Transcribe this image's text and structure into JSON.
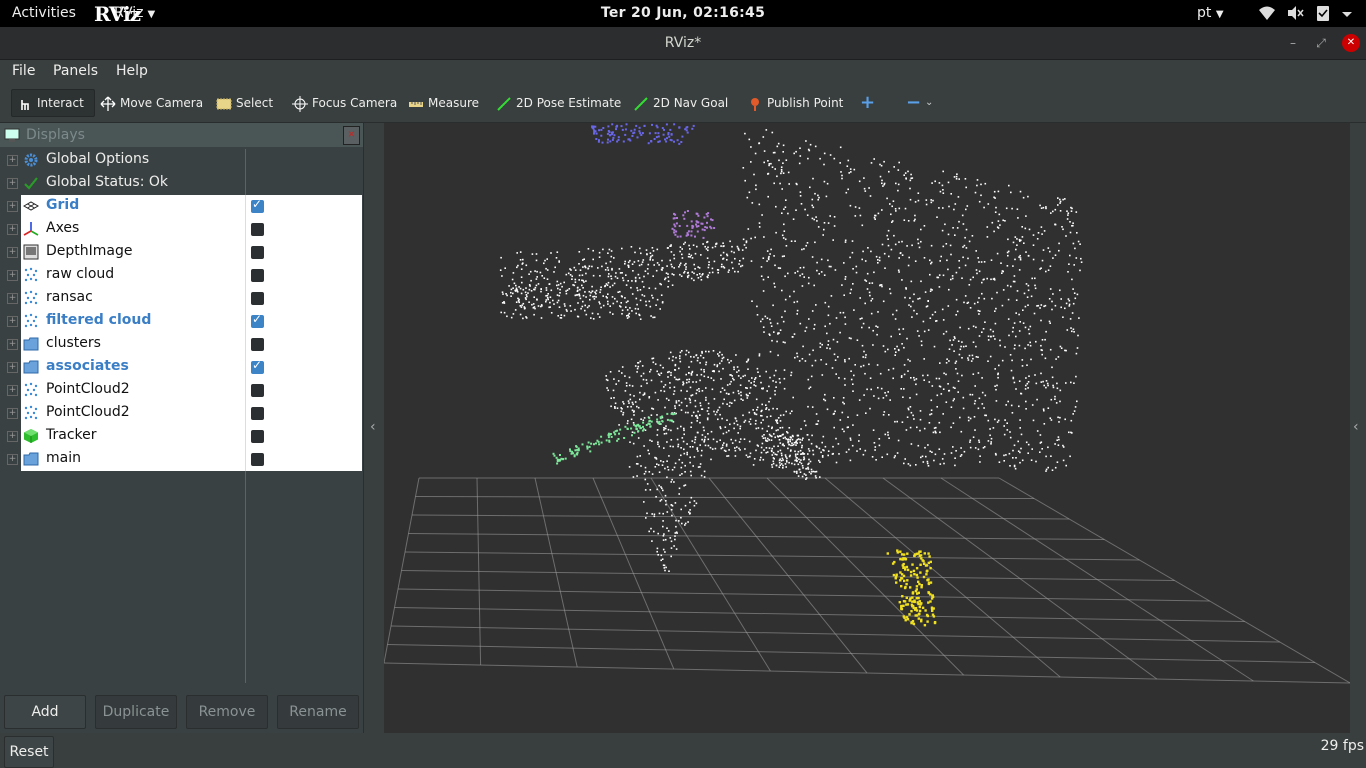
{
  "topbar": {
    "activities": "Activities",
    "app_logo": "RViz",
    "app_name": "RViz",
    "clock": "Ter 20 Jun, 02:16:45",
    "language": "pt"
  },
  "window": {
    "title": "RViz*"
  },
  "menu": {
    "file": "File",
    "panels": "Panels",
    "help": "Help"
  },
  "toolbar": {
    "interact": "Interact",
    "move_camera": "Move Camera",
    "select": "Select",
    "focus_camera": "Focus Camera",
    "measure": "Measure",
    "pose_estimate": "2D Pose Estimate",
    "nav_goal": "2D Nav Goal",
    "publish_point": "Publish Point"
  },
  "displays": {
    "header": "Displays",
    "items": [
      {
        "label": "Global Options",
        "icon": "gear-icon"
      },
      {
        "label": "Global Status: Ok",
        "icon": "check-icon"
      },
      {
        "label": "Grid",
        "icon": "grid-icon",
        "checked": true
      },
      {
        "label": "Axes",
        "icon": "axes-icon",
        "checked": false
      },
      {
        "label": "DepthImage",
        "icon": "image-icon",
        "checked": false
      },
      {
        "label": "raw cloud",
        "icon": "pointcloud-icon",
        "checked": false
      },
      {
        "label": "ransac",
        "icon": "pointcloud-icon",
        "checked": false
      },
      {
        "label": "filtered cloud",
        "icon": "pointcloud-icon",
        "checked": true
      },
      {
        "label": "clusters",
        "icon": "folder-icon",
        "checked": false
      },
      {
        "label": "associates",
        "icon": "folder-icon",
        "checked": true
      },
      {
        "label": "PointCloud2",
        "icon": "pointcloud-icon",
        "checked": false
      },
      {
        "label": "PointCloud2",
        "icon": "pointcloud-icon",
        "checked": false
      },
      {
        "label": "Tracker",
        "icon": "cube-icon",
        "checked": false
      },
      {
        "label": "main",
        "icon": "folder-icon",
        "checked": false
      }
    ],
    "buttons": {
      "add": "Add",
      "duplicate": "Duplicate",
      "remove": "Remove",
      "rename": "Rename"
    }
  },
  "statusbar": {
    "reset": "Reset",
    "fps": "29 fps"
  },
  "colors": {
    "viewport_bg": "#303030",
    "grid": "#a0a0a0",
    "filtered_cloud": "#ffffff",
    "blue_cluster": "#6a66e8",
    "purple_cluster": "#b07ad8",
    "green_cluster": "#7de89a",
    "yellow_cluster": "#f0e020",
    "checkbox_on": "#3d84c6"
  }
}
